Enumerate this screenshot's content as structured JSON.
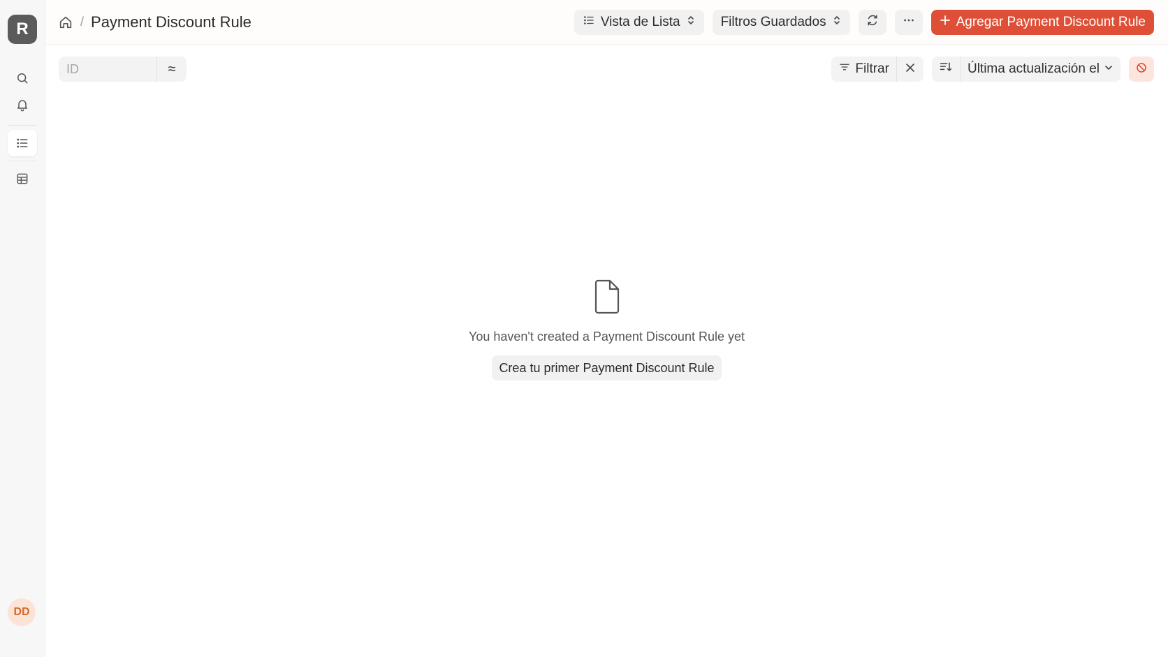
{
  "sidebar": {
    "logo_letter": "R",
    "avatar_initials": "DD",
    "avatar_color": "#d46a30"
  },
  "header": {
    "title": "Payment Discount Rule",
    "view_label": "Vista de Lista",
    "saved_filters_label": "Filtros Guardados",
    "add_button_label": "Agregar Payment Discount Rule",
    "accent_color": "#df4f37"
  },
  "toolbar": {
    "id_placeholder": "ID",
    "approx_symbol": "≈",
    "filter_label": "Filtrar",
    "sort_label": "Última actualización el"
  },
  "empty_state": {
    "message": "You haven't created a Payment Discount Rule yet",
    "create_button_label": "Crea tu primer Payment Discount Rule"
  }
}
